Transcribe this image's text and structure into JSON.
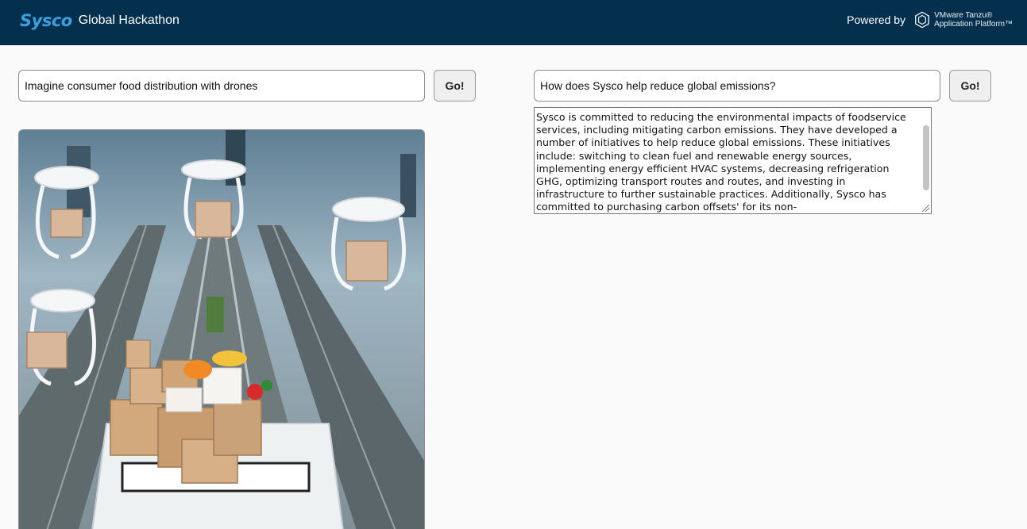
{
  "header": {
    "brand_logo": "Sysco",
    "title": "Global Hackathon",
    "powered_by": "Powered by",
    "vendor_line1": "VMware Tanzu®",
    "vendor_line2": "Application Platform™"
  },
  "left": {
    "prompt_value": "Imagine consumer food distribution with drones",
    "go_label": "Go!",
    "image_icon": "generated-image"
  },
  "right": {
    "question_value": "How does Sysco help reduce global emissions?",
    "go_label": "Go!",
    "answer": "Sysco is committed to reducing the environmental impacts of foodservice services, including mitigating carbon emissions. They have developed a number of initiatives to help reduce global emissions. These initiatives include: switching to clean fuel and renewable energy sources, implementing energy efficient HVAC systems, decreasing refrigeration GHG, optimizing transport routes and routes, and investing in infrastructure to further sustainable practices. Additionally, Sysco has committed to purchasing carbon offsets' for its non-"
  },
  "colors": {
    "header_bg": "#04304e",
    "brand_blue": "#3aa1e0",
    "page_bg": "#fafafa"
  }
}
